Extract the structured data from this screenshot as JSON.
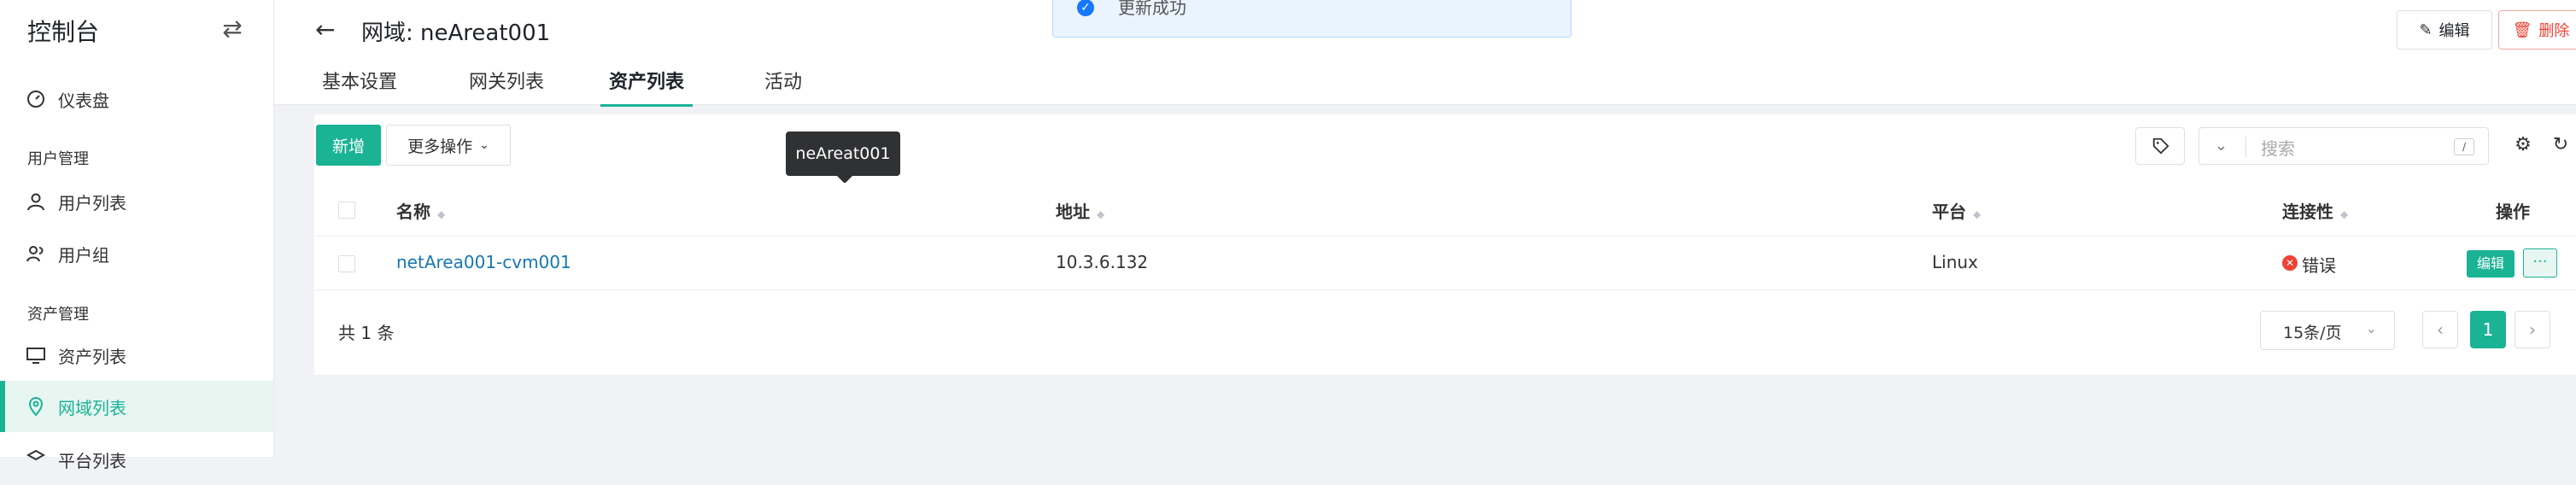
{
  "sidebar": {
    "title": "控制台",
    "toggle_icon": "switch-icon",
    "dashboard": "仪表盘",
    "user_mgmt": "用户管理",
    "user_list": "用户列表",
    "user_group": "用户组",
    "asset_mgmt": "资产管理",
    "asset_list": "资产列表",
    "domain_list": "网域列表",
    "platform_list": "平台列表"
  },
  "header": {
    "title": "网域: neAreat001",
    "tabs": [
      "基本设置",
      "网关列表",
      "资产列表",
      "活动"
    ],
    "active_tab": "资产列表",
    "edit_label": "编辑",
    "delete_label": "删除"
  },
  "toast": {
    "message": "更新成功"
  },
  "toolbar": {
    "create_label": "新增",
    "more_label": "更多操作",
    "tooltip": "neAreat001",
    "search_placeholder": "搜索",
    "search_shortcut": "/"
  },
  "table": {
    "columns": [
      "名称",
      "地址",
      "平台",
      "连接性",
      "操作"
    ],
    "rows": [
      {
        "name": "netArea001-cvm001",
        "address": "10.3.6.132",
        "platform": "Linux",
        "connectivity": "错误",
        "edit": "编辑",
        "more": "···"
      }
    ]
  },
  "pagination": {
    "total": "共 1 条",
    "page_size": "15条/页",
    "current": "1"
  },
  "colors": {
    "accent": "#1ab394",
    "error": "#f04134",
    "link": "#1677b3"
  }
}
